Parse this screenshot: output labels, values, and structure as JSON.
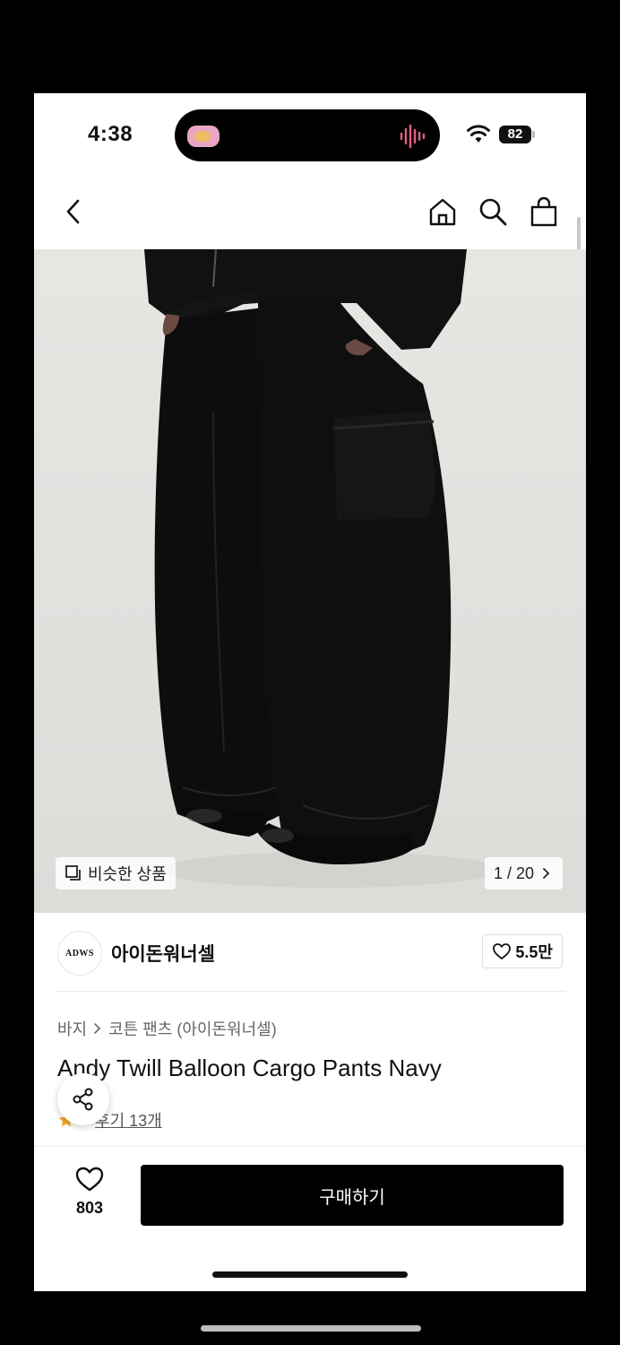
{
  "status_bar": {
    "time": "4:38",
    "battery": "82"
  },
  "hero": {
    "similar_label": "비슷한 상품",
    "counter": "1 / 20"
  },
  "brand": {
    "logo_text": "ADWS",
    "name": "아이돈워너셀",
    "likes": "5.5만"
  },
  "breadcrumb": {
    "category": "바지",
    "subcategory": "코튼 팬츠 (아이돈워너셀)"
  },
  "product": {
    "title": "Andy Twill Balloon Cargo Pants Navy",
    "rating": "5",
    "reviews": "후기 13개"
  },
  "bottom_bar": {
    "wish_count": "803",
    "buy_label": "구매하기"
  },
  "colors": {
    "accent": "#000000",
    "star": "#f5a623",
    "background": "#ffffff"
  }
}
